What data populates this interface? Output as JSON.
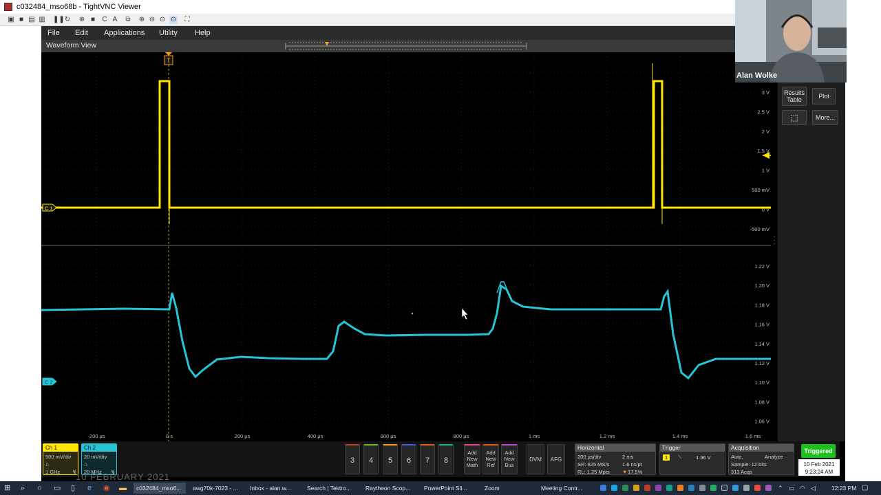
{
  "window": {
    "title": "c032484_mso68b - TightVNC Viewer"
  },
  "menu": [
    "File",
    "Edit",
    "Applications",
    "Utility",
    "Help"
  ],
  "waveform_view": {
    "title": "Waveform View"
  },
  "upper_axis": [
    "3 V",
    "2.5 V",
    "2 V",
    "1.5 V",
    "1 V",
    "500 mV",
    "0 V",
    "-500 mV"
  ],
  "lower_axis": [
    "1.22 V",
    "1.20 V",
    "1.18 V",
    "1.16 V",
    "1.14 V",
    "1.12 V",
    "1.10 V",
    "1.08 V",
    "1.06 V"
  ],
  "time_axis": [
    "-200 µs",
    "0 s",
    "200 µs",
    "400 µs",
    "600 µs",
    "800 µs",
    "1 ms",
    "1.2 ms",
    "1.4 ms",
    "1.6 ms"
  ],
  "markers": {
    "c1": "C 1",
    "c2": "C 2",
    "trigger": "T"
  },
  "side_panel": {
    "results_table": "Results Table",
    "plot": "Plot",
    "more": "More..."
  },
  "webcam": {
    "name": "Alan Wolke"
  },
  "ch1": {
    "label": "Ch 1",
    "scale": "500 mV/div",
    "bw": "1 GHz"
  },
  "ch2": {
    "label": "Ch 2",
    "scale": "20 mV/div",
    "bw": "20 MHz"
  },
  "channel_buttons": [
    "3",
    "4",
    "5",
    "6",
    "7",
    "8"
  ],
  "add_buttons": [
    {
      "line1": "Add",
      "line2": "New",
      "line3": "Math"
    },
    {
      "line1": "Add",
      "line2": "New",
      "line3": "Ref"
    },
    {
      "line1": "Add",
      "line2": "New",
      "line3": "Bus"
    }
  ],
  "tool_buttons": [
    "DVM",
    "AFG"
  ],
  "horizontal": {
    "title": "Horizontal",
    "scale": "200 µs/div",
    "total": "2 ms",
    "sr": "SR: 625 MS/s",
    "pt": "1.6 ns/pt",
    "rl": "RL: 1.25 Mpts",
    "pos": "17.5%"
  },
  "trigger": {
    "title": "Trigger",
    "source": "1",
    "level": "1.36 V"
  },
  "acquisition": {
    "title": "Acquisition",
    "mode": "Auto,",
    "analyze": "Analyze",
    "sample": "Sample: 12 bits",
    "acqs": "313 Acqs"
  },
  "status": {
    "triggered": "Triggered",
    "date": "10 Feb 2021",
    "time": "9:23:24 AM"
  },
  "overlay_text": "10 FEBRUARY 2021",
  "taskbar": {
    "items": [
      "c032484_mso6...",
      "awg70k-7023 - ...",
      "Inbox - alan.w...",
      "Search | Tektro...",
      "Raytheon Scop...",
      "PowerPoint Sli...",
      "Zoom",
      "Meeting Contr..."
    ],
    "clock": "12:23 PM"
  },
  "colors": {
    "ch1": "#ffe600",
    "ch2": "#27c4d6",
    "trigger_marker": "#f59a23",
    "triggered": "#1ec01e"
  }
}
